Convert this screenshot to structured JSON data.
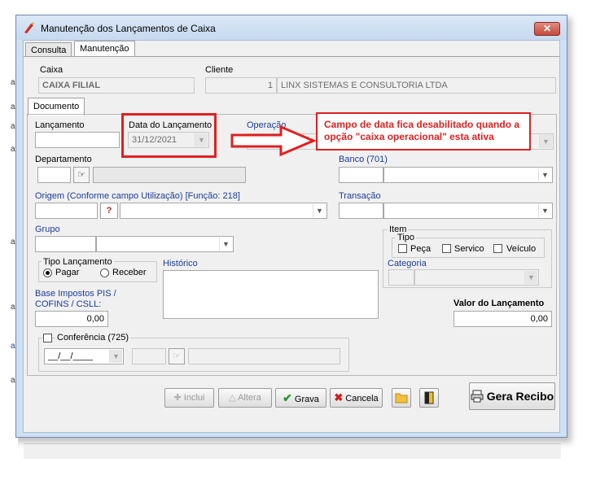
{
  "window": {
    "title": "Manutenção dos Lançamentos de Caixa",
    "close": "✕"
  },
  "tabs": {
    "consulta": "Consulta",
    "manutencao": "Manutenção"
  },
  "caixa": {
    "label": "Caixa",
    "value": "CAIXA FILIAL"
  },
  "cliente": {
    "label": "Cliente",
    "code": "1",
    "name": "LINX SISTEMAS E CONSULTORIA LTDA"
  },
  "documento": {
    "tab": "Documento",
    "lancamento_label": "Lançamento",
    "data_label": "Data do Lançamento",
    "data_value": "31/12/2021",
    "operacao_label": "Operação",
    "departamento_label": "Departamento",
    "banco_label": "Banco (701)",
    "origem_label": "Origem (Conforme campo Utilização) [Função: 218]",
    "transacao_label": "Transação",
    "grupo_label": "Grupo",
    "item_group": "Item",
    "tipo_group": "Tipo",
    "tipo_options": [
      "Peça",
      "Servico",
      "Veículo"
    ],
    "categoria_label": "Categoria",
    "tipo_lancamento_group": "Tipo Lançamento",
    "tipo_lancamento_options": [
      "Pagar",
      "Receber"
    ],
    "tipo_lancamento_selected": "Pagar",
    "historico_label": "Histórico",
    "base_impostos_label_1": "Base Impostos PIS /",
    "base_impostos_label_2": "COFINS / CSLL:",
    "base_impostos_value": "0,00",
    "valor_label": "Valor do Lançamento",
    "valor_value": "0,00",
    "conferencia_label": "Conferência (725)",
    "conferencia_date": "__/__/____",
    "origem_icon_text": "?"
  },
  "annotation": {
    "text": "Campo de data fica desabilitado quando a opção \"caixa operacional\" esta ativa"
  },
  "buttons": {
    "inclui": "Inclui",
    "altera": "Altera",
    "grava": "Grava",
    "cancela": "Cancela",
    "gera_recibo": "Gera Recibo"
  },
  "colors": {
    "annotation": "#e02020",
    "blue_label": "#1a3c9c",
    "window_border": "#6d8bb3"
  }
}
